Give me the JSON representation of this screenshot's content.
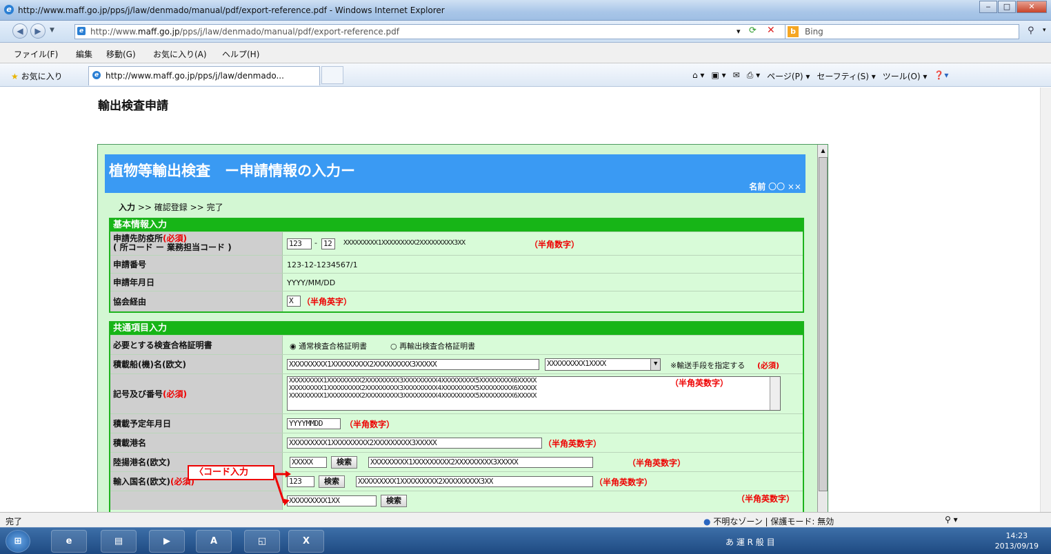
{
  "window": {
    "title": "http://www.maff.go.jp/pps/j/law/denmado/manual/pdf/export-reference.pdf - Windows Internet Explorer",
    "min": "‒",
    "max": "□",
    "close": "✕"
  },
  "address": {
    "url_prefix": "http://www.",
    "url_domain": "maff.go.jp",
    "url_path": "/pps/j/law/denmado/manual/pdf/export-reference.pdf",
    "search_text": "Bing"
  },
  "menu": [
    "ファイル(F)",
    "編集",
    "移動(G)",
    "お気に入り(A)",
    "ヘルプ(H)"
  ],
  "favorites": {
    "label": "お気に入り",
    "tab_title": "http://www.maff.go.jp/pps/j/law/denmado..."
  },
  "commandbar": {
    "page": "ページ(P) ▾",
    "safety": "セーフティ(S) ▾",
    "tools": "ツール(O) ▾"
  },
  "page": {
    "title": "輸出検査申請"
  },
  "panel": {
    "banner_title": "植物等輸出検査　ー申請情報の入力ー",
    "user_label": "名前",
    "user_value": "〇〇 ××",
    "breadcrumb": {
      "step1": "入力",
      "sep": ">>",
      "step2": "確認登録",
      "step3": "完了"
    }
  },
  "basic": {
    "header": "基本情報入力",
    "office_label": "申請先防疫所",
    "office_required": "(必須)",
    "office_sublabel": "( 所コード ー 業務担当コード )",
    "office_code": "123",
    "office_dash": "-",
    "office_staff": "12",
    "office_name": "XXXXXXXXX1XXXXXXXXX2XXXXXXXXX3XX",
    "office_hint": "（半角数字）",
    "appno_label": "申請番号",
    "appno_value": "123-12-1234567/1",
    "appdate_label": "申請年月日",
    "appdate_value": "YYYY/MM/DD",
    "assoc_label": "協会経由",
    "assoc_value": "X",
    "assoc_hint": "（半角英字）"
  },
  "common": {
    "header": "共通項目入力",
    "cert_label": "必要とする検査合格証明書",
    "cert_opt1": "通常検査合格証明書",
    "cert_opt2": "再輸出検査合格証明書",
    "cert_selected": "通常検査合格証明書",
    "vessel_label": "積載船(機)名(欧文)",
    "vessel_value": "XXXXXXXXX1XXXXXXXXX2XXXXXXXXX3XXXXX",
    "vessel_select": "XXXXXXXXX1XXXX",
    "vessel_note": "※輸送手段を指定する",
    "vessel_required": "(必須)",
    "marks_label": "記号及び番号",
    "marks_required": "(必須)",
    "marks_lines": [
      "XXXXXXXXX1XXXXXXXXX2XXXXXXXXX3XXXXXXXXX4XXXXXXXXX5XXXXXXXXX6XXXXX",
      "XXXXXXXXX1XXXXXXXXX2XXXXXXXXX3XXXXXXXXX4XXXXXXXXX5XXXXXXXXX6XXXXX",
      "XXXXXXXXX1XXXXXXXXX2XXXXXXXXX3XXXXXXXXX4XXXXXXXXX5XXXXXXXXX6XXXXX"
    ],
    "marks_hint": "（半角英数字）",
    "loaddate_label": "積載予定年月日",
    "loaddate_value": "YYYYMMDD",
    "loaddate_hint": "（半角数字）",
    "loadport_label": "積載港名",
    "loadport_value": "XXXXXXXXX1XXXXXXXXX2XXXXXXXXX3XXXXX",
    "loadport_hint": "（半角英数字）",
    "unloadport_label": "陸揚港名(欧文)",
    "unloadport_code": "XXXXX",
    "unloadport_search": "検索",
    "unloadport_name": "XXXXXXXXX1XXXXXXXXX2XXXXXXXXX3XXXXX",
    "unloadport_hint": "（半角英数字）",
    "country_label": "輸入国名(欧文)",
    "country_required": "(必須)",
    "country_code": "123",
    "country_search": "検索",
    "country_name": "XXXXXXXXX1XXXXXXXXX2XXXXXXXXX3XX",
    "country_hint": "（半角英数字）",
    "next_code": "XXXXXXXXX1XX",
    "next_search": "検索",
    "next_hint": "（半角英数字）",
    "callout": "〈コード入力"
  },
  "status": {
    "left": "完了",
    "zone": "不明なゾーン | 保護モード: 無効",
    "zoom": "▾"
  },
  "taskbar": {
    "time": "14:23",
    "date": "2013/09/19",
    "ime": "あ 運 R 般 目"
  },
  "colors": {
    "banner_blue": "#3a9af3",
    "section_green": "#17b517",
    "panel_bg": "#d3f7d3",
    "required_red": "#e00000"
  }
}
